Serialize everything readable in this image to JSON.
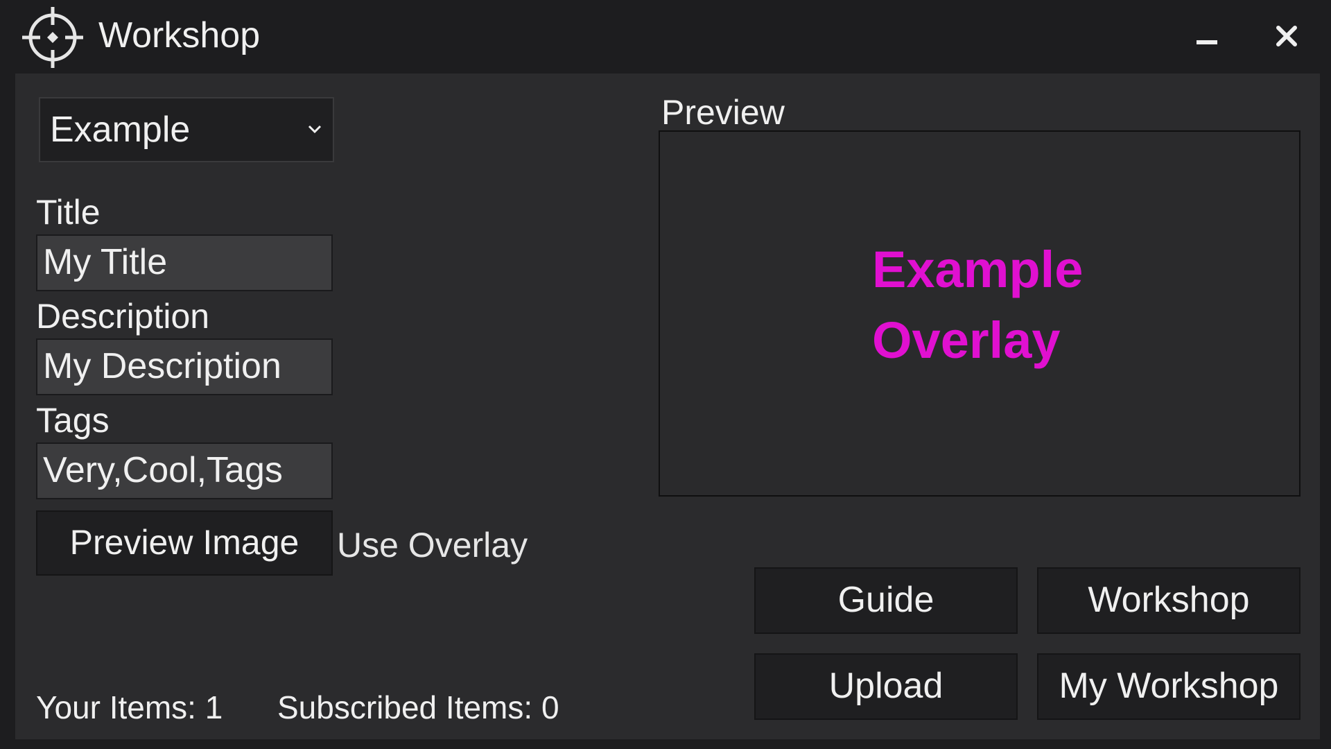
{
  "window": {
    "title": "Workshop",
    "icon": "crosshair-icon"
  },
  "controls": {
    "minimize_icon": "minimize-icon",
    "close_icon": "close-icon",
    "close_glyph": "✕"
  },
  "form": {
    "item_select": {
      "value": "Example"
    },
    "title": {
      "label": "Title",
      "value": "My Title"
    },
    "description": {
      "label": "Description",
      "value": "My Description"
    },
    "tags": {
      "label": "Tags",
      "value": "Very,Cool,Tags"
    },
    "preview_image_button": "Preview Image",
    "use_overlay_label": "Use Overlay"
  },
  "preview": {
    "label": "Preview",
    "overlay_line1": "Example",
    "overlay_line2": "Overlay",
    "overlay_color": "#e010d0"
  },
  "actions": {
    "guide": "Guide",
    "workshop": "Workshop",
    "upload": "Upload",
    "my_workshop": "My Workshop"
  },
  "status": {
    "your_items": "Your Items: 1",
    "subscribed_items": "Subscribed Items: 0"
  }
}
